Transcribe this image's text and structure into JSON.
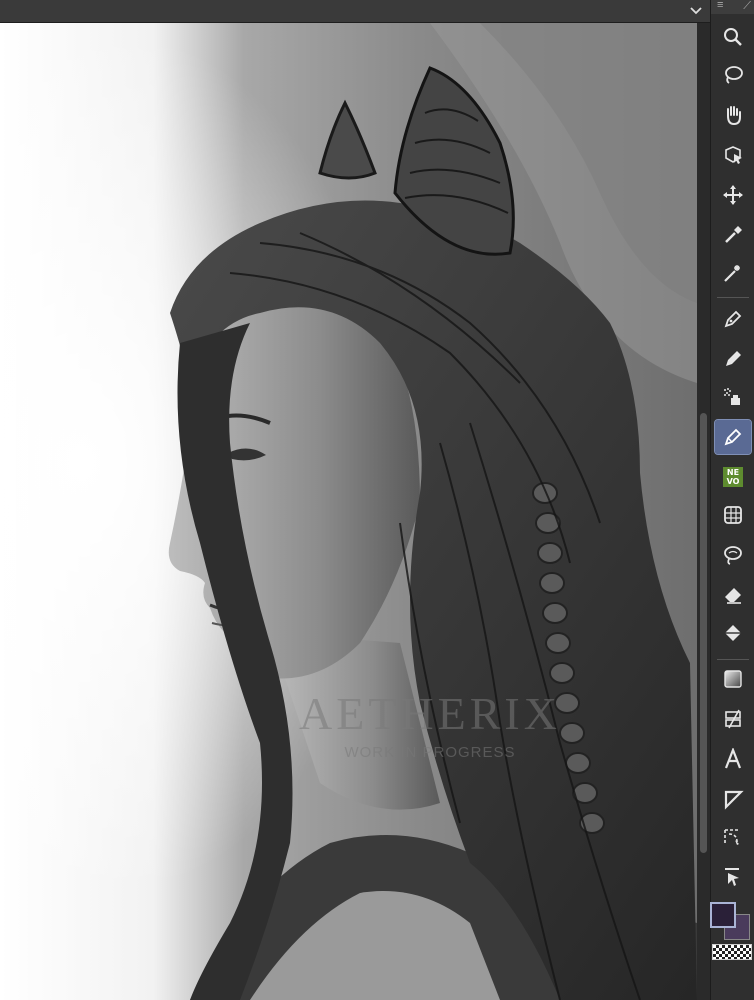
{
  "canvas": {
    "watermark_title": "AETHERIX",
    "watermark_subtitle": "WORK IN PROGRESS"
  },
  "toolbar": {
    "header_menu": "≡",
    "header_pin": "⟋",
    "tools": [
      {
        "name": "zoom-tool",
        "icon": "magnifier-icon"
      },
      {
        "name": "lasso-select-tool",
        "icon": "lasso-icon"
      },
      {
        "name": "hand-tool",
        "icon": "hand-icon"
      },
      {
        "name": "object-select-tool",
        "icon": "object-cursor-icon"
      },
      {
        "name": "move-tool",
        "icon": "move-arrows-icon"
      },
      {
        "name": "eyedropper-tool",
        "icon": "eyedropper-icon"
      },
      {
        "name": "magic-wand-tool",
        "icon": "magic-wand-icon"
      },
      {
        "name": "pen-tool",
        "icon": "pen-nib-icon"
      },
      {
        "name": "pencil-tool",
        "icon": "pencil-icon"
      },
      {
        "name": "airbrush-tool",
        "icon": "airbrush-icon"
      },
      {
        "name": "brush-tool",
        "icon": "brush-icon",
        "active": true
      },
      {
        "name": "nevo-plugin",
        "icon": "nevo-icon"
      },
      {
        "name": "decoration-tool",
        "icon": "pattern-icon"
      },
      {
        "name": "blend-tool",
        "icon": "blend-icon"
      },
      {
        "name": "eraser-tool",
        "icon": "eraser-icon"
      },
      {
        "name": "fill-tool",
        "icon": "bucket-icon"
      },
      {
        "name": "gradient-tool",
        "icon": "gradient-icon"
      },
      {
        "name": "figure-tool",
        "icon": "figure-icon"
      },
      {
        "name": "text-tool",
        "icon": "text-icon"
      },
      {
        "name": "frame-tool",
        "icon": "frame-icon"
      },
      {
        "name": "ruler-tool",
        "icon": "ruler-icon"
      },
      {
        "name": "operation-tool",
        "icon": "operation-cursor-icon"
      }
    ],
    "nevo_line1": "NE",
    "nevo_line2": "VO"
  },
  "colors": {
    "main_color": "#2a2038",
    "sub_color": "#4a3b5c",
    "active_tool": "#5a6a94"
  }
}
